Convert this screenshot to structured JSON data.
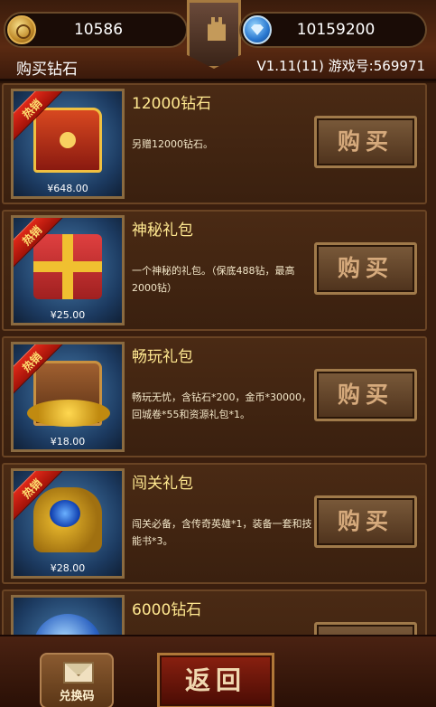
{
  "currency": {
    "gold_value": "10586",
    "diamond_value": "10159200"
  },
  "header": {
    "title": "购买钻石",
    "version": "V1.11(11) 游戏号:569971"
  },
  "products": [
    {
      "title": "12000钻石",
      "description": "另赠12000钻石。",
      "price": "¥648.00",
      "badge": "热销",
      "buy_label": "购买",
      "art_icon": "treasure-chest-icon"
    },
    {
      "title": "神秘礼包",
      "description": "一个神秘的礼包。（保底488钻，最高2000钻）",
      "price": "¥25.00",
      "badge": "热销",
      "buy_label": "购买",
      "art_icon": "gift-box-icon"
    },
    {
      "title": "畅玩礼包",
      "description": "畅玩无忧，含钻石*200，金币*30000，回城卷*55和资源礼包*1。",
      "price": "¥18.00",
      "badge": "热销",
      "buy_label": "购买",
      "art_icon": "gold-coin-chest-icon"
    },
    {
      "title": "闯关礼包",
      "description": "闯关必备，含传奇英雄*1，装备一套和技能书*3。",
      "price": "¥28.00",
      "badge": "热销",
      "buy_label": "购买",
      "art_icon": "gem-treasure-icon"
    },
    {
      "title": "6000钻石",
      "description": "",
      "price": "",
      "badge": "",
      "buy_label": "",
      "art_icon": "diamond-icon"
    }
  ],
  "footer": {
    "redeem_label": "兑换码",
    "back_label": "返回"
  }
}
